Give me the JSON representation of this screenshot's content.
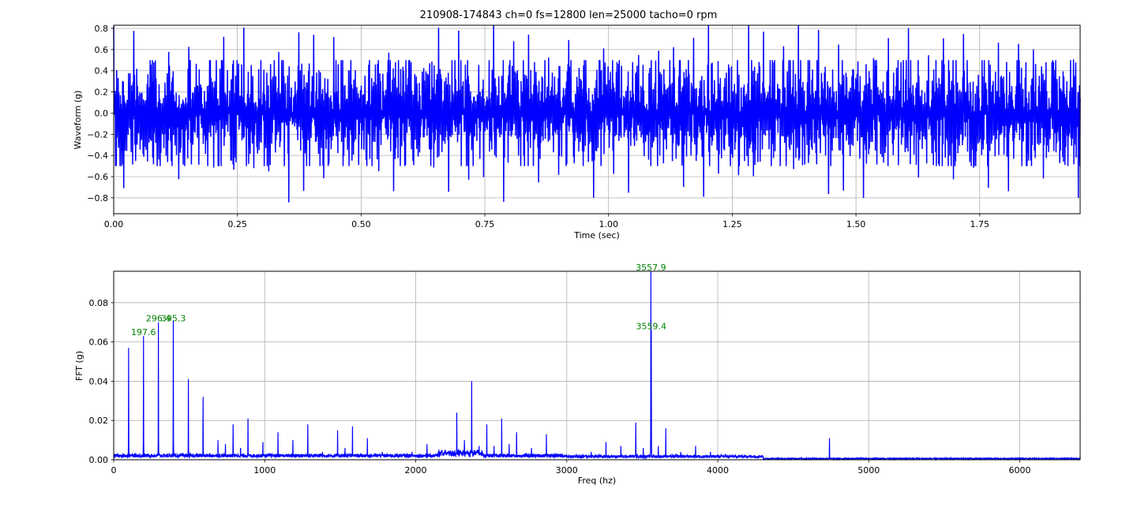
{
  "title": "210908-174843 ch=0 fs=12800 len=25000 tacho=0 rpm",
  "colors": {
    "series": "#0000ff",
    "annotation": "#008000",
    "grid": "#b0b0b0"
  },
  "chart_data": [
    {
      "type": "line",
      "xlabel": "Time (sec)",
      "ylabel": "Waveform (g)",
      "xlim": [
        0,
        1.953
      ],
      "ylim": [
        -0.95,
        0.83
      ],
      "xticks": [
        0,
        0.25,
        0.5,
        0.75,
        1.0,
        1.25,
        1.5,
        1.75
      ],
      "xtick_labels": [
        "0.00",
        "0.25",
        "0.50",
        "0.75",
        "1.00",
        "1.25",
        "1.50",
        "1.75"
      ],
      "yticks": [
        -0.8,
        -0.6,
        -0.4,
        -0.2,
        0.0,
        0.2,
        0.4,
        0.6,
        0.8
      ],
      "ytick_labels": [
        "−0.8",
        "−0.6",
        "−0.4",
        "−0.2",
        "0.0",
        "0.2",
        "0.4",
        "0.6",
        "0.8"
      ],
      "grid": true,
      "series": [
        {
          "sample_rate": 12800,
          "length": 25000,
          "typical_amplitude": 0.35,
          "impulse_interval_sec": 0.0101,
          "impulse_peak_range": [
            0.4,
            0.85
          ]
        }
      ]
    },
    {
      "type": "line",
      "xlabel": "Freq (hz)",
      "ylabel": "FFT (g)",
      "xlim": [
        0,
        6400
      ],
      "ylim": [
        0,
        0.096
      ],
      "xticks": [
        0,
        1000,
        2000,
        3000,
        4000,
        5000,
        6000
      ],
      "xtick_labels": [
        "0",
        "1000",
        "2000",
        "3000",
        "4000",
        "5000",
        "6000"
      ],
      "yticks": [
        0,
        0.02,
        0.04,
        0.06,
        0.08
      ],
      "ytick_labels": [
        "0.00",
        "0.02",
        "0.04",
        "0.06",
        "0.08"
      ],
      "grid": true,
      "peaks": [
        [
          99,
          0.057
        ],
        [
          197.6,
          0.063
        ],
        [
          296.4,
          0.07
        ],
        [
          395.3,
          0.071
        ],
        [
          494,
          0.041
        ],
        [
          592,
          0.032
        ],
        [
          690,
          0.01
        ],
        [
          740,
          0.008
        ],
        [
          790,
          0.018
        ],
        [
          840,
          0.006
        ],
        [
          889,
          0.021
        ],
        [
          988,
          0.009
        ],
        [
          1088,
          0.014
        ],
        [
          1186,
          0.01
        ],
        [
          1285,
          0.018
        ],
        [
          1383,
          0.004
        ],
        [
          1482,
          0.015
        ],
        [
          1532,
          0.006
        ],
        [
          1581,
          0.017
        ],
        [
          1680,
          0.011
        ],
        [
          1778,
          0.004
        ],
        [
          1877,
          0.003
        ],
        [
          1976,
          0.004
        ],
        [
          2075,
          0.008
        ],
        [
          2173,
          0.005
        ],
        [
          2272,
          0.024
        ],
        [
          2322,
          0.01
        ],
        [
          2371,
          0.04
        ],
        [
          2420,
          0.007
        ],
        [
          2470,
          0.018
        ],
        [
          2519,
          0.007
        ],
        [
          2569,
          0.021
        ],
        [
          2618,
          0.008
        ],
        [
          2668,
          0.014
        ],
        [
          2766,
          0.006
        ],
        [
          2865,
          0.013
        ],
        [
          2964,
          0.003
        ],
        [
          3063,
          0.003
        ],
        [
          3161,
          0.004
        ],
        [
          3260,
          0.009
        ],
        [
          3358,
          0.007
        ],
        [
          3457,
          0.019
        ],
        [
          3507,
          0.006
        ],
        [
          3557.9,
          0.096
        ],
        [
          3559.4,
          0.066
        ],
        [
          3606,
          0.007
        ],
        [
          3656,
          0.016
        ],
        [
          3754,
          0.004
        ],
        [
          3853,
          0.007
        ],
        [
          3952,
          0.004
        ],
        [
          4050,
          0.003
        ],
        [
          4150,
          0.002
        ],
        [
          4249,
          0.002
        ],
        [
          4740,
          0.011
        ]
      ],
      "annotations": [
        {
          "text": "197.6",
          "x": 197.6,
          "y": 0.063
        },
        {
          "text": "296.4",
          "x": 296.4,
          "y": 0.07
        },
        {
          "text": "395.3",
          "x": 395.3,
          "y": 0.07
        },
        {
          "text": "3557.9",
          "x": 3557.9,
          "y": 0.096
        },
        {
          "text": "3559.4",
          "x": 3559.4,
          "y": 0.066
        }
      ]
    }
  ]
}
